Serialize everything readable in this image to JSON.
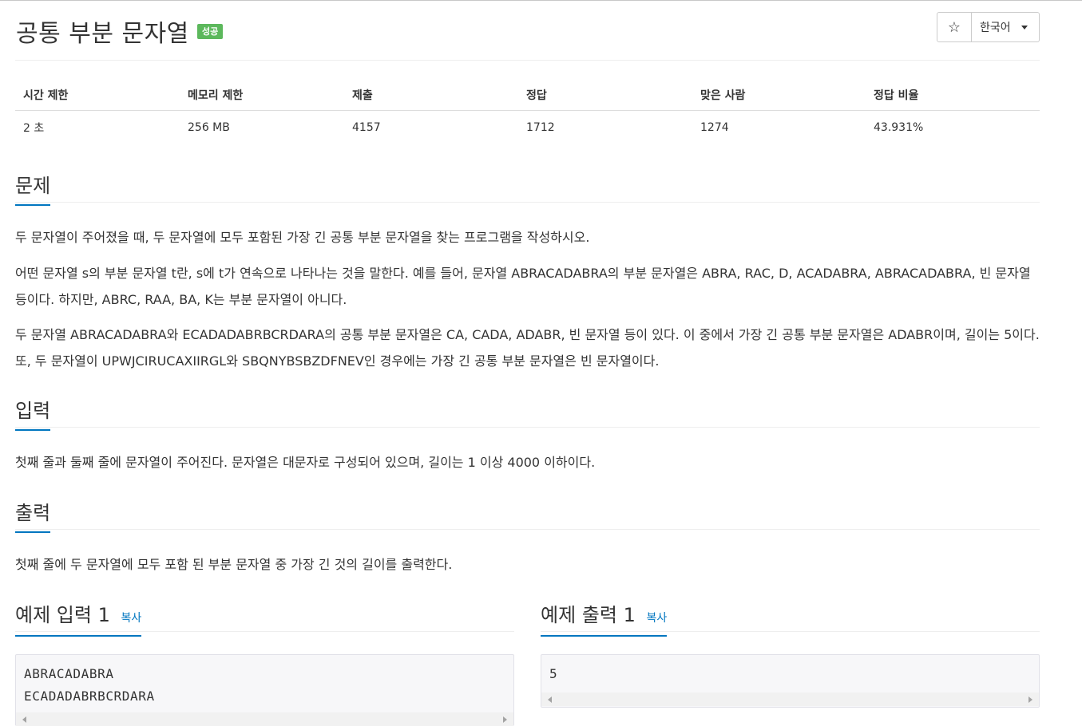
{
  "header": {
    "title": "공통 부분 문자열",
    "badge": "성공",
    "star_icon": "☆",
    "language": "한국어"
  },
  "info_table": {
    "headers": [
      "시간 제한",
      "메모리 제한",
      "제출",
      "정답",
      "맞은 사람",
      "정답 비율"
    ],
    "values": [
      "2 초",
      "256 MB",
      "4157",
      "1712",
      "1274",
      "43.931%"
    ]
  },
  "problem": {
    "heading": "문제",
    "paragraphs": [
      "두 문자열이 주어졌을 때, 두 문자열에 모두 포함된 가장 긴 공통 부분 문자열을 찾는 프로그램을 작성하시오.",
      "어떤 문자열 s의 부분 문자열 t란, s에 t가 연속으로 나타나는 것을 말한다. 예를 들어, 문자열 ABRACADABRA의 부분 문자열은 ABRA, RAC, D, ACADABRA, ABRACADABRA, 빈 문자열 등이다. 하지만, ABRC, RAA, BA, K는 부분 문자열이 아니다.",
      "두 문자열 ABRACADABRA와 ECADADABRBCRDARA의 공통 부분 문자열은 CA, CADA, ADABR, 빈 문자열 등이 있다. 이 중에서 가장 긴 공통 부분 문자열은 ADABR이며, 길이는 5이다. 또, 두 문자열이 UPWJCIRUCAXIIRGL와 SBQNYBSBZDFNEV인 경우에는 가장 긴 공통 부분 문자열은 빈 문자열이다."
    ]
  },
  "input": {
    "heading": "입력",
    "text": "첫째 줄과 둘째 줄에 문자열이 주어진다. 문자열은 대문자로 구성되어 있으며, 길이는 1 이상 4000 이하이다."
  },
  "output": {
    "heading": "출력",
    "text": "첫째 줄에 두 문자열에 모두 포함 된 부분 문자열 중 가장 긴 것의 길이를 출력한다."
  },
  "example_input": {
    "heading": "예제 입력 1",
    "copy_label": "복사",
    "lines": [
      "ABRACADABRA",
      "ECADADABRBCRDARA"
    ]
  },
  "example_output": {
    "heading": "예제 출력 1",
    "copy_label": "복사",
    "lines": [
      "5"
    ]
  },
  "colors": {
    "accent": "#0076c0",
    "badge_success": "#5cb85c"
  }
}
